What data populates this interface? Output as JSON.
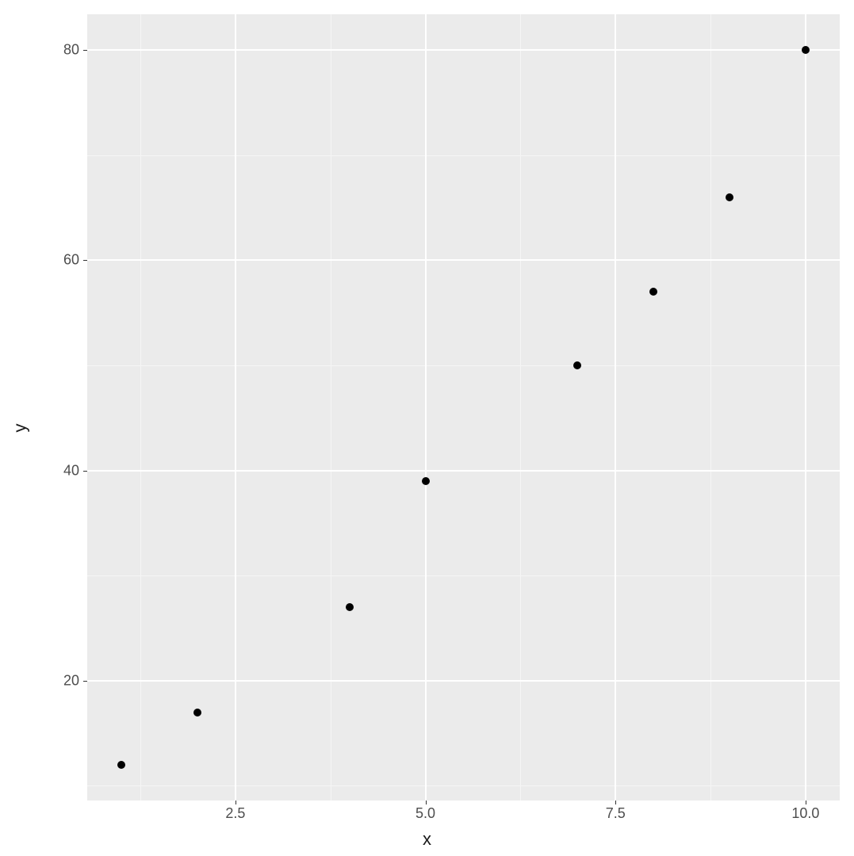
{
  "chart_data": {
    "type": "scatter",
    "xlabel": "x",
    "ylabel": "y",
    "x_ticks": [
      2.5,
      5.0,
      7.5,
      10.0
    ],
    "x_tick_labels": [
      "2.5",
      "5.0",
      "7.5",
      "10.0"
    ],
    "y_ticks": [
      20,
      40,
      60,
      80
    ],
    "y_tick_labels": [
      "20",
      "40",
      "60",
      "80"
    ],
    "xlim": [
      0.55,
      10.45
    ],
    "ylim": [
      8.6,
      83.4
    ],
    "x_minor": [
      1.25,
      3.75,
      6.25,
      8.75
    ],
    "y_minor": [
      10,
      30,
      50,
      70
    ],
    "points": [
      {
        "x": 1,
        "y": 12
      },
      {
        "x": 2,
        "y": 17
      },
      {
        "x": 4,
        "y": 27
      },
      {
        "x": 5,
        "y": 39
      },
      {
        "x": 7,
        "y": 50
      },
      {
        "x": 8,
        "y": 57
      },
      {
        "x": 9,
        "y": 66
      },
      {
        "x": 10,
        "y": 80
      }
    ]
  }
}
